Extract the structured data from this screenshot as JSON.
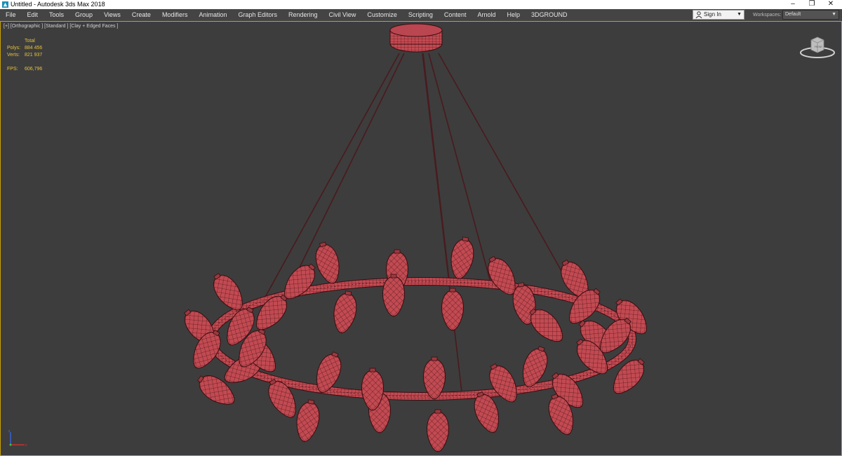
{
  "window": {
    "title": "Untitled - Autodesk 3ds Max 2018",
    "controls": {
      "minimize": "–",
      "restore": "❐",
      "close": "✕"
    }
  },
  "menu": {
    "items": [
      {
        "label": "File"
      },
      {
        "label": "Edit"
      },
      {
        "label": "Tools"
      },
      {
        "label": "Group"
      },
      {
        "label": "Views"
      },
      {
        "label": "Create"
      },
      {
        "label": "Modifiers"
      },
      {
        "label": "Animation"
      },
      {
        "label": "Graph Editors"
      },
      {
        "label": "Rendering"
      },
      {
        "label": "Civil View"
      },
      {
        "label": "Customize"
      },
      {
        "label": "Scripting"
      },
      {
        "label": "Content"
      },
      {
        "label": "Arnold"
      },
      {
        "label": "Help"
      },
      {
        "label": "3DGROUND"
      }
    ]
  },
  "account": {
    "sign_in_label": "Sign In"
  },
  "workspaces": {
    "label": "Workspaces:",
    "value": "Default"
  },
  "viewport": {
    "label": "[+] [Orthographic ] [Standard ] [Clay + Edged Faces ]",
    "stats": {
      "total_label": "Total",
      "polys_label": "Polys:",
      "polys_value": "884 456",
      "verts_label": "Verts:",
      "verts_value": "821 937",
      "fps_label": "FPS:",
      "fps_value": "606,796"
    },
    "viewcube_face": "FRONT",
    "model_color": "#c24a52",
    "wire_color": "#3a0c10",
    "background_color": "#3d3d3d"
  }
}
